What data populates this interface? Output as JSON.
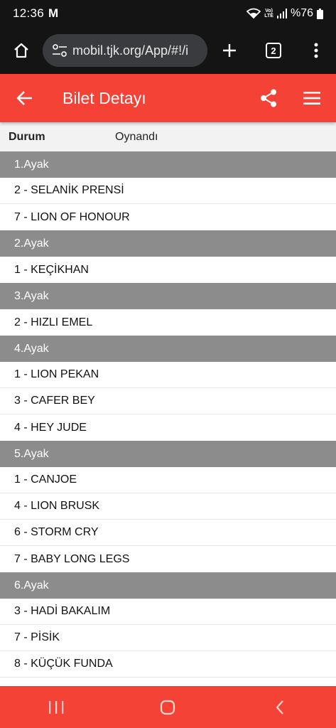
{
  "status_bar": {
    "time": "12:36",
    "app_badge": "M",
    "volte_line1": "Vo)",
    "volte_line2": "LTE",
    "battery": "%76"
  },
  "browser": {
    "url": "mobil.tjk.org/App/#!/i",
    "tab_count": "2"
  },
  "header": {
    "title": "Bilet Detayı"
  },
  "ticket": {
    "status_label": "Durum",
    "status_value": "Oynandı"
  },
  "legs": [
    {
      "label": "1.Ayak",
      "horses": [
        "2 - SELANİK PRENSİ",
        "7 - LION OF HONOUR"
      ]
    },
    {
      "label": "2.Ayak",
      "horses": [
        "1 - KEÇİKHAN"
      ]
    },
    {
      "label": "3.Ayak",
      "horses": [
        "2 - HIZLI EMEL"
      ]
    },
    {
      "label": "4.Ayak",
      "horses": [
        "1 - LION PEKAN",
        "3 - CAFER BEY",
        "4 - HEY JUDE"
      ]
    },
    {
      "label": "5.Ayak",
      "horses": [
        "1 - CANJOE",
        "4 - LION BRUSK",
        "6 - STORM CRY",
        "7 - BABY LONG LEGS"
      ]
    },
    {
      "label": "6.Ayak",
      "horses": [
        "3 - HADİ BAKALIM",
        "7 - PİSİK",
        "8 - KÜÇÜK FUNDA"
      ]
    }
  ],
  "colors": {
    "accent": "#f44336",
    "leg_header_bg": "#8c8c8c",
    "browser_bg": "#141414"
  },
  "icons": {
    "home": "home-icon",
    "site_settings": "tune-icon",
    "new_tab": "plus-icon",
    "tabs": "tab-switcher-icon",
    "browser_menu": "more-vert-icon",
    "back": "arrow-back-icon",
    "share": "share-icon",
    "menu": "hamburger-menu-icon",
    "nav_recents": "recents-icon",
    "nav_home": "nav-home-icon",
    "nav_back": "nav-back-icon"
  }
}
